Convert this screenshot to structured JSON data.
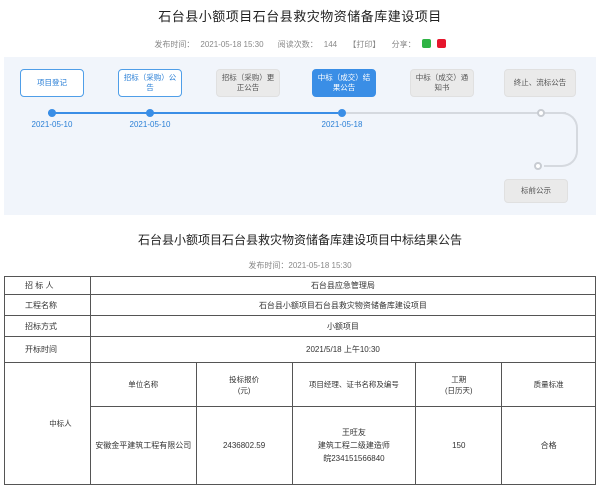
{
  "page": {
    "title": "石台县小额项目石台县救灾物资储备库建设项目",
    "meta": {
      "publish_label": "发布时间：",
      "publish_time": "2021-05-18 15:30",
      "views_label": "阅读次数：",
      "views": "144",
      "print_label": "【打印】",
      "share_label": "分享："
    }
  },
  "flow": {
    "steps": [
      {
        "label": "项目登记",
        "state": "done"
      },
      {
        "label": "招标（采购）公告",
        "state": "done"
      },
      {
        "label": "招标（采购）更正公告",
        "state": "pending"
      },
      {
        "label": "中标（成交）结果公告",
        "state": "active"
      },
      {
        "label": "中标（成交）通知书",
        "state": "pending"
      },
      {
        "label": "终止、流标公告",
        "state": "pending"
      },
      {
        "label": "标前公示",
        "state": "pending"
      }
    ],
    "dates": [
      "2021-05-10",
      "2021-05-10",
      "2021-05-18"
    ]
  },
  "announcement": {
    "title": "石台县小额项目石台县救灾物资储备库建设项目中标结果公告",
    "publish_time": "发布时间：2021-05-18 15:30",
    "rows": [
      {
        "label": "招 标 人",
        "value": "石台县应急管理局"
      },
      {
        "label": "工程名称",
        "value": "石台县小额项目石台县救灾物资储备库建设项目"
      },
      {
        "label": "招标方式",
        "value": "小额项目"
      },
      {
        "label": "开标时间",
        "value": "2021/5/18 上午10:30"
      }
    ],
    "winner": {
      "label": "中标人",
      "headers": [
        "单位名称",
        "投标报价\n(元)",
        "项目经理、证书名称及编号",
        "工期\n(日历天)",
        "质量标准"
      ],
      "row": {
        "company": "安徽金平建筑工程有限公司",
        "bid": "2436802.59",
        "manager": "王旺友",
        "cert": "建筑工程二级建造师",
        "cert_no": "皖234151566840",
        "period": "150",
        "quality": "合格"
      }
    }
  }
}
